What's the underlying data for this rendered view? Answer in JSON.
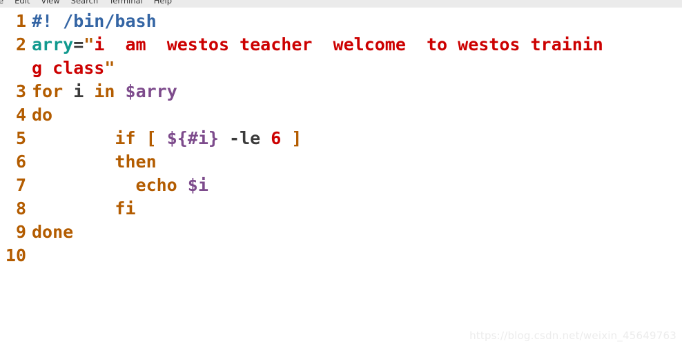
{
  "window": {
    "menu_items": [
      "e",
      "Edit",
      "View",
      "Search",
      "Terminal",
      "Help"
    ],
    "menu_bar_bg": "#ebebeb"
  },
  "colors": {
    "background": "#ffffff",
    "line_number": "#b35c00",
    "comment": "#3465a4",
    "variable": "#11998e",
    "string": "#cc0000",
    "quote": "#b35c00",
    "keyword": "#b35c00",
    "substitution": "#7d4b8c",
    "number": "#cc0000",
    "plain": "#3b3b3b",
    "watermark": "#ececec"
  },
  "editor": {
    "rows": [
      {
        "number": "1",
        "tokens": [
          {
            "text": "#! /bin/bash",
            "kind": "comment"
          }
        ]
      },
      {
        "number": "2",
        "tokens": [
          {
            "text": "arry",
            "kind": "var"
          },
          {
            "text": "=",
            "kind": "plain"
          },
          {
            "text": "\"",
            "kind": "quote"
          },
          {
            "text": "i  am  westos teacher  welcome  to westos trainin",
            "kind": "string"
          }
        ]
      },
      {
        "number": "",
        "tokens": [
          {
            "text": "g class",
            "kind": "string"
          },
          {
            "text": "\"",
            "kind": "quote"
          }
        ]
      },
      {
        "number": "3",
        "tokens": [
          {
            "text": "for",
            "kind": "keyword"
          },
          {
            "text": " ",
            "kind": "plain"
          },
          {
            "text": "i",
            "kind": "plain"
          },
          {
            "text": " ",
            "kind": "plain"
          },
          {
            "text": "in",
            "kind": "keyword"
          },
          {
            "text": " ",
            "kind": "plain"
          },
          {
            "text": "$arry",
            "kind": "subst"
          }
        ]
      },
      {
        "number": "4",
        "tokens": [
          {
            "text": "do",
            "kind": "keyword"
          }
        ]
      },
      {
        "number": "5",
        "tokens": [
          {
            "text": "        ",
            "kind": "plain"
          },
          {
            "text": "if",
            "kind": "keyword"
          },
          {
            "text": " ",
            "kind": "plain"
          },
          {
            "text": "[",
            "kind": "bracket"
          },
          {
            "text": " ",
            "kind": "plain"
          },
          {
            "text": "${#i}",
            "kind": "subst"
          },
          {
            "text": " ",
            "kind": "plain"
          },
          {
            "text": "-le",
            "kind": "plain"
          },
          {
            "text": " ",
            "kind": "plain"
          },
          {
            "text": "6",
            "kind": "number"
          },
          {
            "text": " ",
            "kind": "plain"
          },
          {
            "text": "]",
            "kind": "bracket"
          }
        ]
      },
      {
        "number": "6",
        "tokens": [
          {
            "text": "        ",
            "kind": "plain"
          },
          {
            "text": "then",
            "kind": "keyword"
          }
        ]
      },
      {
        "number": "7",
        "tokens": [
          {
            "text": "          ",
            "kind": "plain"
          },
          {
            "text": "echo",
            "kind": "builtin"
          },
          {
            "text": " ",
            "kind": "plain"
          },
          {
            "text": "$i",
            "kind": "subst"
          }
        ]
      },
      {
        "number": "8",
        "tokens": [
          {
            "text": "        ",
            "kind": "plain"
          },
          {
            "text": "fi",
            "kind": "keyword"
          }
        ]
      },
      {
        "number": "9",
        "tokens": [
          {
            "text": "done",
            "kind": "keyword"
          }
        ]
      },
      {
        "number": "10",
        "tokens": []
      }
    ]
  },
  "watermark": {
    "text": "https://blog.csdn.net/weixin_45649763"
  }
}
